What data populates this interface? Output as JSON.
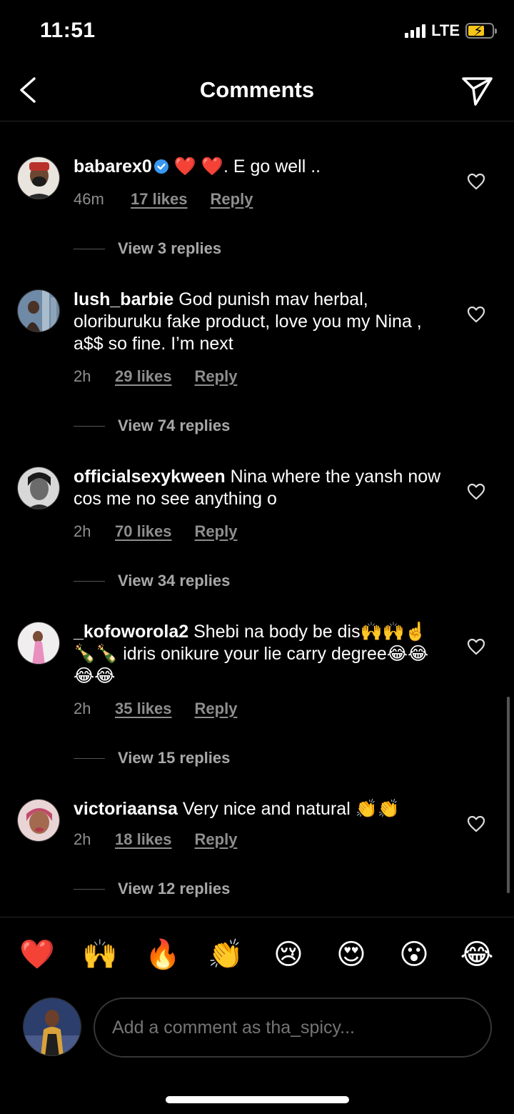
{
  "status_bar": {
    "time": "11:51",
    "network": "LTE"
  },
  "nav": {
    "title": "Comments"
  },
  "comments": [
    {
      "username": "babarex0",
      "verified": true,
      "text": " ❤️ ❤️. E go well ..",
      "time": "46m",
      "likes": "17 likes",
      "reply": "Reply",
      "view_replies": "View 3 replies"
    },
    {
      "username": "lush_barbie",
      "verified": false,
      "text": " God punish mav herbal, oloriburuku fake product,  love you my Nina , a$$ so fine. I’m next",
      "time": "2h",
      "likes": "29 likes",
      "reply": "Reply",
      "view_replies": "View 74 replies"
    },
    {
      "username": "officialsexykween",
      "verified": false,
      "text": " Nina where the yansh now cos me no see anything o",
      "time": "2h",
      "likes": "70 likes",
      "reply": "Reply",
      "view_replies": "View 34 replies"
    },
    {
      "username": "_kofoworola2",
      "verified": false,
      "text": " Shebi na body be dis🙌🙌☝️🍾🍾 idris onikure your lie carry degree😂😂😂😂",
      "time": "2h",
      "likes": "35 likes",
      "reply": "Reply",
      "view_replies": "View 15 replies"
    },
    {
      "username": "victoriaansa",
      "verified": false,
      "text": " Very nice and natural 👏👏",
      "time": "2h",
      "likes": "18 likes",
      "reply": "Reply",
      "view_replies": "View 12 replies"
    }
  ],
  "emoji_bar": [
    "❤️",
    "🙌",
    "🔥",
    "👏",
    "😢",
    "😍",
    "😮",
    "😂"
  ],
  "composer": {
    "placeholder": "Add a comment as tha_spicy..."
  },
  "colors": {
    "background": "#000000",
    "secondary_text": "#8e8e8e",
    "verified": "#3897f0",
    "battery": "#f5c518"
  }
}
